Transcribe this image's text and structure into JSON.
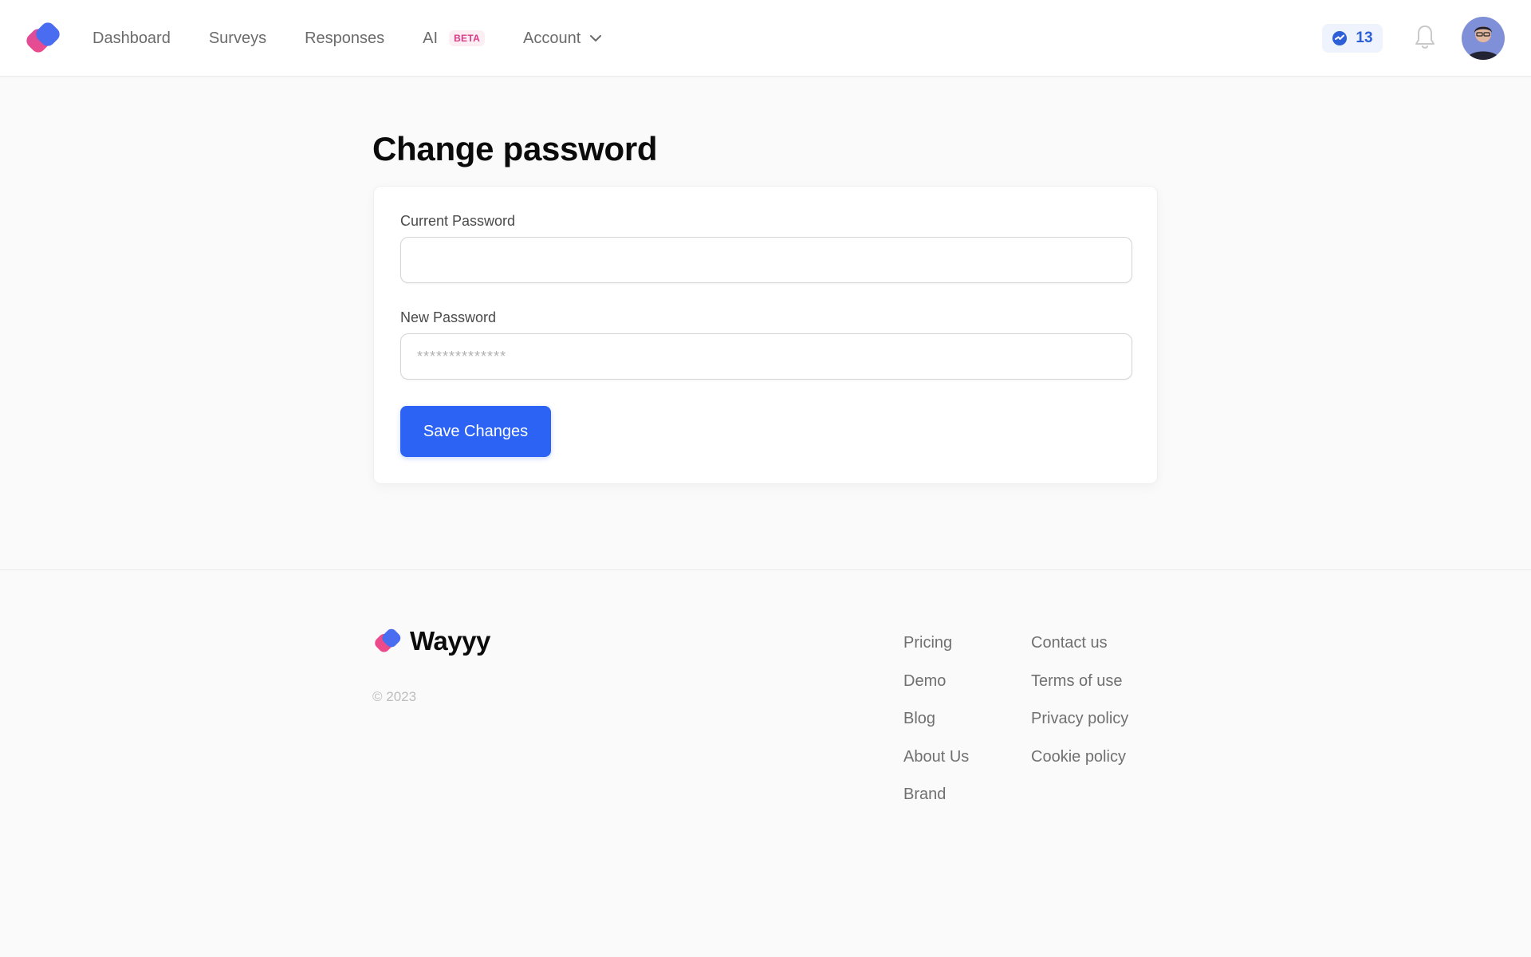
{
  "nav": {
    "items": [
      {
        "label": "Dashboard"
      },
      {
        "label": "Surveys"
      },
      {
        "label": "Responses"
      },
      {
        "label": "AI",
        "badge": "BETA"
      },
      {
        "label": "Account",
        "icon": "chevron-down-icon"
      }
    ],
    "credits_count": "13",
    "credits_icon": "lightning-badge-icon",
    "notifications_icon": "bell-icon"
  },
  "page": {
    "title": "Change password"
  },
  "form": {
    "current_password_label": "Current Password",
    "current_password_value": "",
    "new_password_label": "New Password",
    "new_password_placeholder": "**************",
    "save_label": "Save Changes"
  },
  "footer": {
    "brand": "Wayyy",
    "copyright": "© 2023",
    "col1": [
      "Pricing",
      "Demo",
      "Blog",
      "About Us",
      "Brand"
    ],
    "col2": [
      "Contact us",
      "Terms of use",
      "Privacy policy",
      "Cookie policy"
    ]
  },
  "colors": {
    "accent": "#2d63f5",
    "brand_pink": "#e84f8f",
    "brand_blue": "#4a6cf0",
    "badge_pink": "#d93a85"
  }
}
